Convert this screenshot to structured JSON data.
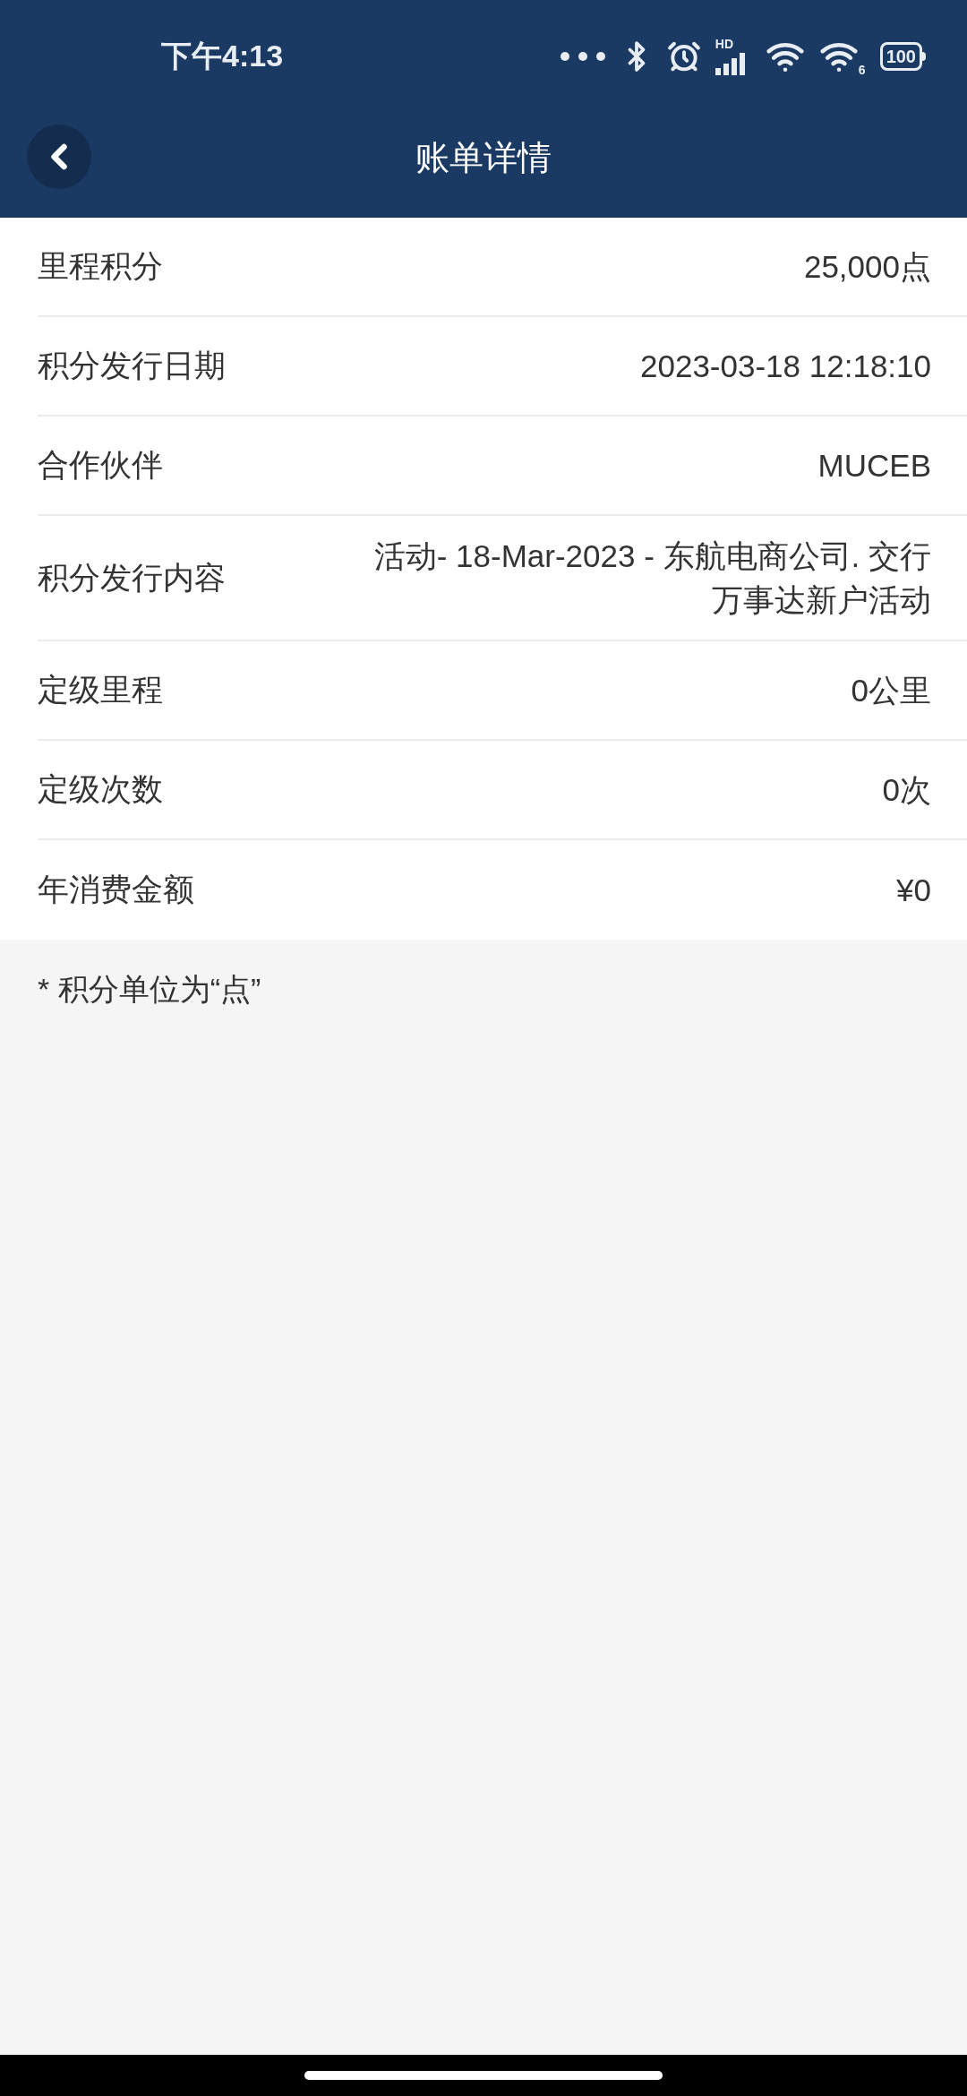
{
  "status_bar": {
    "time": "下午4:13",
    "signal_label": "HD",
    "wifi_label": "6",
    "battery": "100"
  },
  "header": {
    "title": "账单详情"
  },
  "rows": [
    {
      "label": "里程积分",
      "value": "25,000点"
    },
    {
      "label": "积分发行日期",
      "value": "2023-03-18 12:18:10"
    },
    {
      "label": "合作伙伴",
      "value": "MUCEB"
    },
    {
      "label": "积分发行内容",
      "value": "活动- 18-Mar-2023 - 东航电商公司. 交行万事达新户活动"
    },
    {
      "label": "定级里程",
      "value": "0公里"
    },
    {
      "label": "定级次数",
      "value": "0次"
    },
    {
      "label": "年消费金额",
      "value": "¥0"
    }
  ],
  "note": "* 积分单位为“点”"
}
